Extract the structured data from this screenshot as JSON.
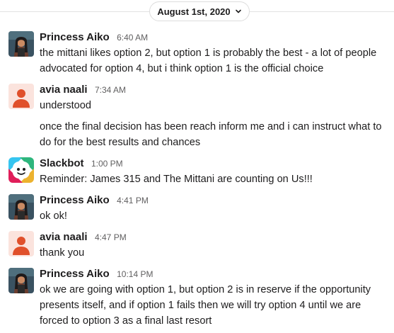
{
  "date_divider": {
    "label": "August 1st, 2020"
  },
  "messages": [
    {
      "author": "Princess Aiko",
      "time": "6:40 AM",
      "text": "the mittani likes option 2, but option 1 is probably the best - a lot of people advocated for option 4, but i think option 1 is the official choice"
    },
    {
      "author": "avia naali",
      "time": "7:34 AM",
      "text": "understood",
      "continuation": "once the final decision has been reach inform me and i can instruct what to do for the best results and chances"
    },
    {
      "author": "Slackbot",
      "time": "1:00 PM",
      "text": "Reminder: James 315 and The Mittani are counting on Us!!!"
    },
    {
      "author": "Princess Aiko",
      "time": "4:41 PM",
      "text": "ok ok!"
    },
    {
      "author": "avia naali",
      "time": "4:47 PM",
      "text": "thank you"
    },
    {
      "author": "Princess Aiko",
      "time": "10:14 PM",
      "text": "ok we are going with option 1, but option 2 is in reserve if the opportunity presents itself, and if option 1 fails then we will try option 4 until we are forced to option 3 as a final last resort"
    }
  ],
  "colors": {
    "default_avatar_bg": "#fbe3dd",
    "default_avatar_fg": "#e0502b",
    "slackbot_blue": "#36c5f0",
    "slackbot_green": "#2eb67d",
    "slackbot_yellow": "#ecb22e",
    "slackbot_red": "#e01e5a"
  },
  "icons": {
    "date_menu": "chevron-down-icon",
    "default_avatar": "default-user-avatar-icon",
    "photo_avatar": "user-photo-avatar",
    "slackbot_avatar": "slackbot-avatar-icon"
  }
}
